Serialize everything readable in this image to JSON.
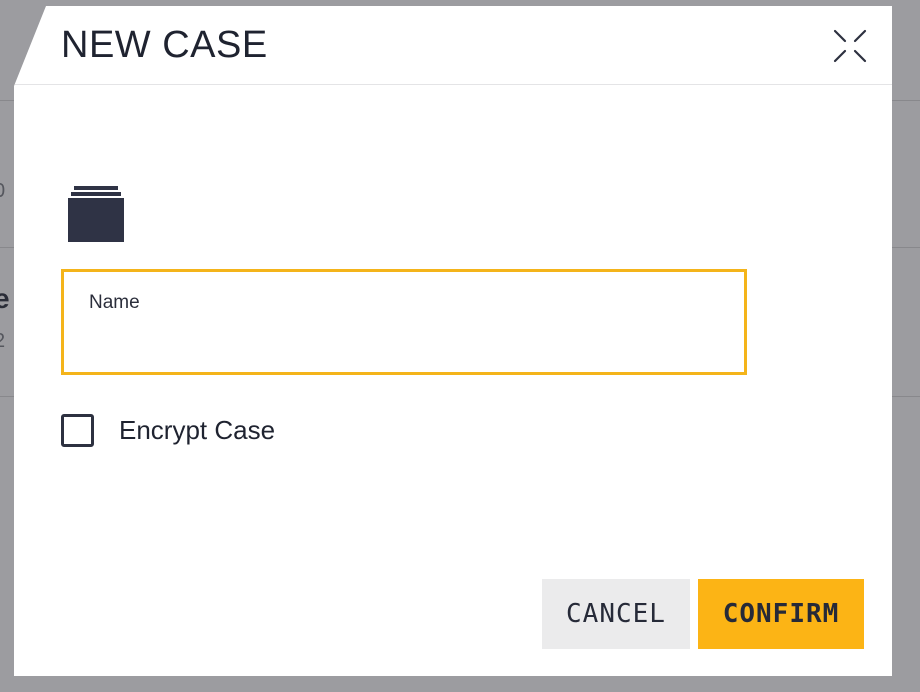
{
  "background": {
    "fragments": [
      "0",
      "e",
      "2"
    ]
  },
  "dialog": {
    "title": "NEW CASE",
    "close_icon": "collapse-arrows-icon",
    "case_icon": "folder-stack-icon",
    "name_field": {
      "label": "Name",
      "value": ""
    },
    "encrypt_checkbox": {
      "label": "Encrypt Case",
      "checked": false
    },
    "buttons": {
      "cancel": "CANCEL",
      "confirm": "CONFIRM"
    }
  },
  "colors": {
    "accent": "#fcb415",
    "field_border": "#f4b41a",
    "text_dark": "#1f2330",
    "icon": "#2f3345",
    "cancel_bg": "#ebebec"
  }
}
